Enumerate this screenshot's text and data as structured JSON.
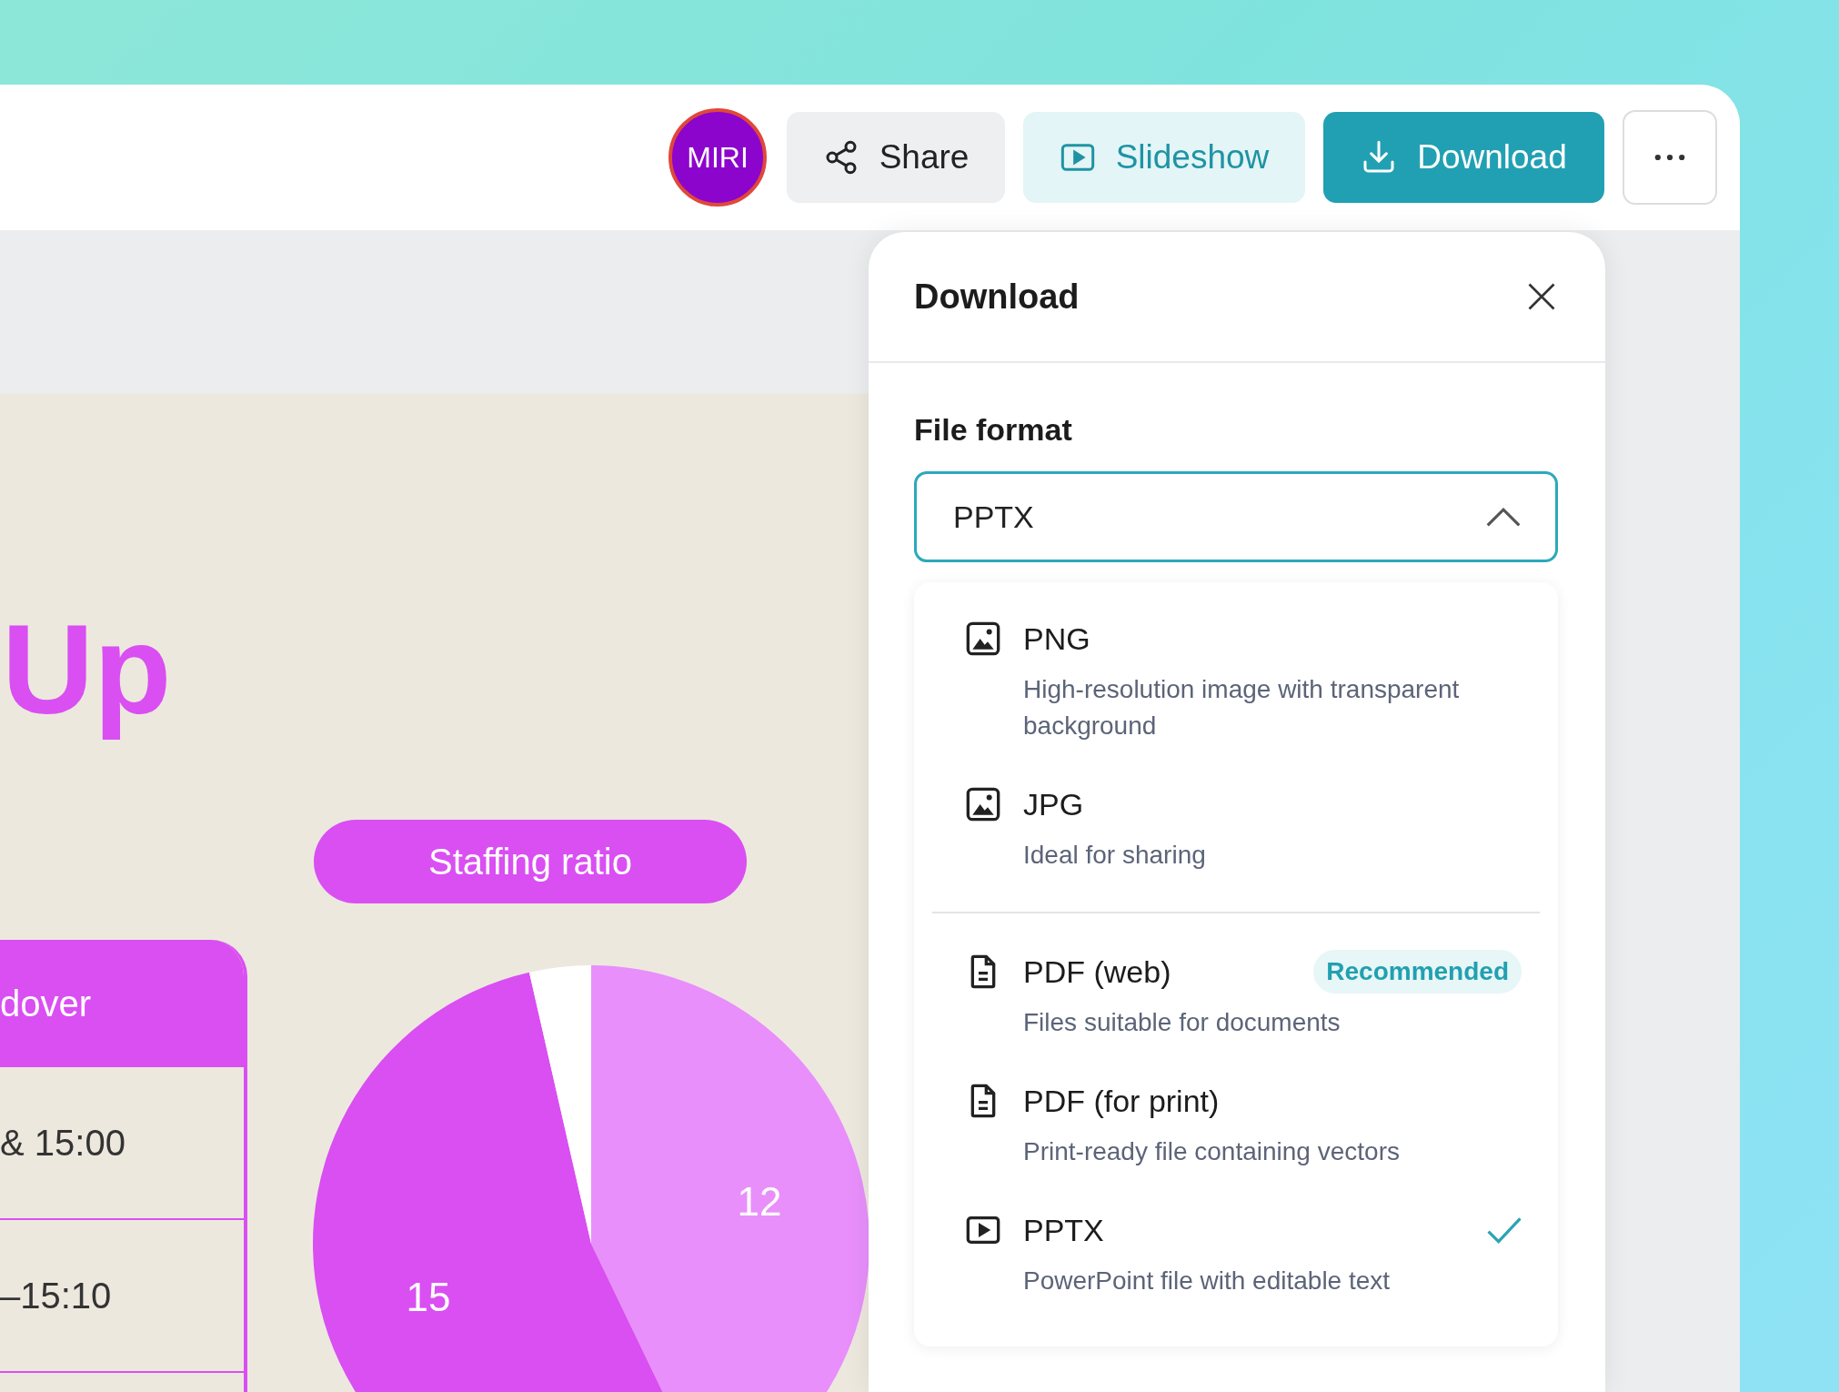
{
  "header": {
    "avatar": {
      "initials": "MIRI"
    },
    "buttons": [
      {
        "kind": "share",
        "label": "Share"
      },
      {
        "kind": "slideshow",
        "label": "Slideshow"
      },
      {
        "kind": "download",
        "label": "Download"
      },
      {
        "kind": "more"
      }
    ]
  },
  "slide": {
    "title": "Up",
    "pill": "Staffing ratio",
    "table": {
      "header": "dover",
      "rows": [
        "& 15:00",
        "–15:10"
      ]
    },
    "chart_data": {
      "type": "pie",
      "values": [
        12,
        15,
        1
      ],
      "value_labels": [
        "12",
        "15",
        null
      ],
      "colors": [
        "#e88ffb",
        "#d94ff2",
        "#ffffff"
      ]
    }
  },
  "dialog": {
    "title": "Download",
    "field_label": "File format",
    "select": {
      "value": "PPTX",
      "expanded": true
    },
    "options": [
      {
        "kind": "image",
        "label": "PNG",
        "description": "High-resolution image with transparent background",
        "selected": false,
        "divider_before": false
      },
      {
        "kind": "image",
        "label": "JPG",
        "description": "Ideal for sharing",
        "selected": false,
        "divider_before": false
      },
      {
        "kind": "document",
        "label": "PDF (web)",
        "description": "Files suitable for documents",
        "badge": "Recommended",
        "selected": false,
        "divider_before": true
      },
      {
        "kind": "document",
        "label": "PDF (for print)",
        "description": "Print-ready file containing vectors",
        "selected": false,
        "divider_before": false
      },
      {
        "kind": "presentation",
        "label": "PPTX",
        "description": "PowerPoint file with editable text",
        "selected": true,
        "divider_before": false
      }
    ]
  }
}
